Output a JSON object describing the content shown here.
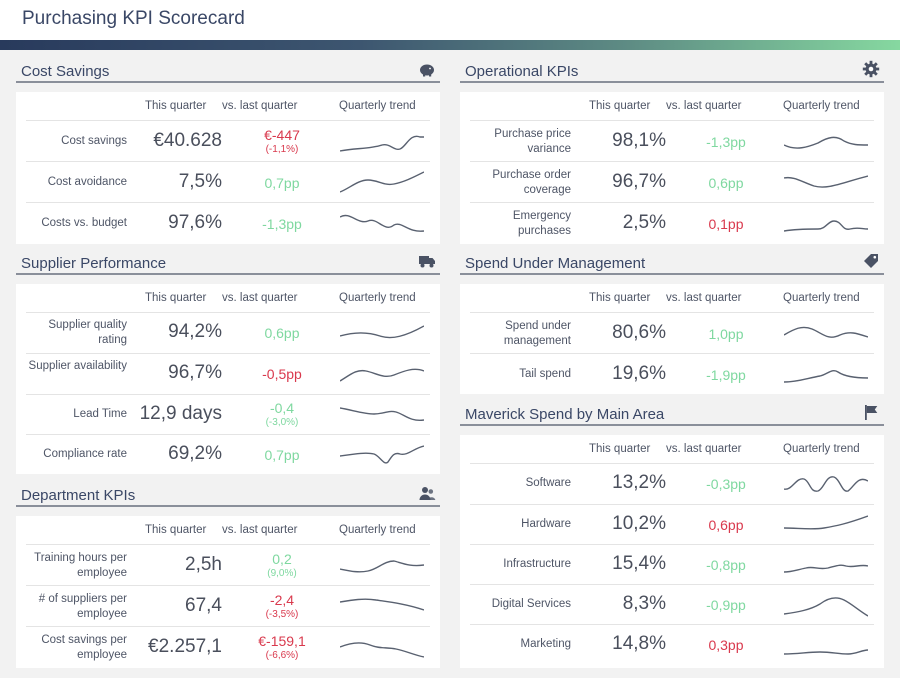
{
  "title": "Purchasing KPI Scorecard",
  "columns": {
    "current": "This quarter",
    "change": "vs. last quarter",
    "trend": "Quarterly trend"
  },
  "sections": {
    "cost": {
      "title": "Cost Savings",
      "icon": "piggy-bank-icon",
      "rows": [
        {
          "label": "Cost savings",
          "value": "€40.628",
          "delta": "€-447",
          "delta_sub": "(-1,1%)",
          "status": "neg"
        },
        {
          "label": "Cost avoidance",
          "value": "7,5%",
          "delta": "0,7pp",
          "status": "pos"
        },
        {
          "label": "Costs vs. budget",
          "value": "97,6%",
          "delta": "-1,3pp",
          "status": "pos"
        }
      ]
    },
    "operational": {
      "title": "Operational KPIs",
      "icon": "gear-icon",
      "rows": [
        {
          "label": "Purchase price variance",
          "value": "98,1%",
          "delta": "-1,3pp",
          "status": "pos"
        },
        {
          "label": "Purchase order coverage",
          "value": "96,7%",
          "delta": "0,6pp",
          "status": "pos"
        },
        {
          "label": "Emergency purchases",
          "value": "2,5%",
          "delta": "0,1pp",
          "status": "neg"
        }
      ]
    },
    "supplier": {
      "title": "Supplier Performance",
      "icon": "truck-icon",
      "rows": [
        {
          "label": "Supplier quality rating",
          "value": "94,2%",
          "delta": "0,6pp",
          "status": "pos"
        },
        {
          "label": "Supplier availability",
          "value": "96,7%",
          "delta": "-0,5pp",
          "status": "neg"
        },
        {
          "label": "Lead Time",
          "value": "12,9 days",
          "delta": "-0,4",
          "delta_sub": "(-3,0%)",
          "status": "pos"
        },
        {
          "label": "Compliance rate",
          "value": "69,2%",
          "delta": "0,7pp",
          "status": "pos"
        }
      ]
    },
    "spend": {
      "title": "Spend Under Management",
      "icon": "tag-icon",
      "rows": [
        {
          "label": "Spend under management",
          "value": "80,6%",
          "delta": "1,0pp",
          "status": "pos"
        },
        {
          "label": "Tail spend",
          "value": "19,6%",
          "delta": "-1,9pp",
          "status": "pos"
        }
      ]
    },
    "department": {
      "title": "Department KPIs",
      "icon": "people-icon",
      "rows": [
        {
          "label": "Training hours per employee",
          "value": "2,5h",
          "delta": "0,2",
          "delta_sub": "(9,0%)",
          "status": "pos"
        },
        {
          "label": "# of suppliers per employee",
          "value": "67,4",
          "delta": "-2,4",
          "delta_sub": "(-3,5%)",
          "status": "neg"
        },
        {
          "label": "Cost savings per employee",
          "value": "€2.257,1",
          "delta": "€-159,1",
          "delta_sub": "(-6,6%)",
          "status": "neg"
        }
      ]
    },
    "maverick": {
      "title": "Maverick Spend by Main Area",
      "icon": "flag-icon",
      "rows": [
        {
          "label": "Software",
          "value": "13,2%",
          "delta": "-0,3pp",
          "status": "pos"
        },
        {
          "label": "Hardware",
          "value": "10,2%",
          "delta": "0,6pp",
          "status": "neg"
        },
        {
          "label": "Infrastructure",
          "value": "15,4%",
          "delta": "-0,8pp",
          "status": "pos"
        },
        {
          "label": "Digital Services",
          "value": "8,3%",
          "delta": "-0,9pp",
          "status": "pos"
        },
        {
          "label": "Marketing",
          "value": "14,8%",
          "delta": "0,3pp",
          "status": "neg"
        }
      ]
    }
  },
  "colors": {
    "positive": "#7fd8a0",
    "negative": "#d9394d",
    "title": "#3a4766"
  }
}
